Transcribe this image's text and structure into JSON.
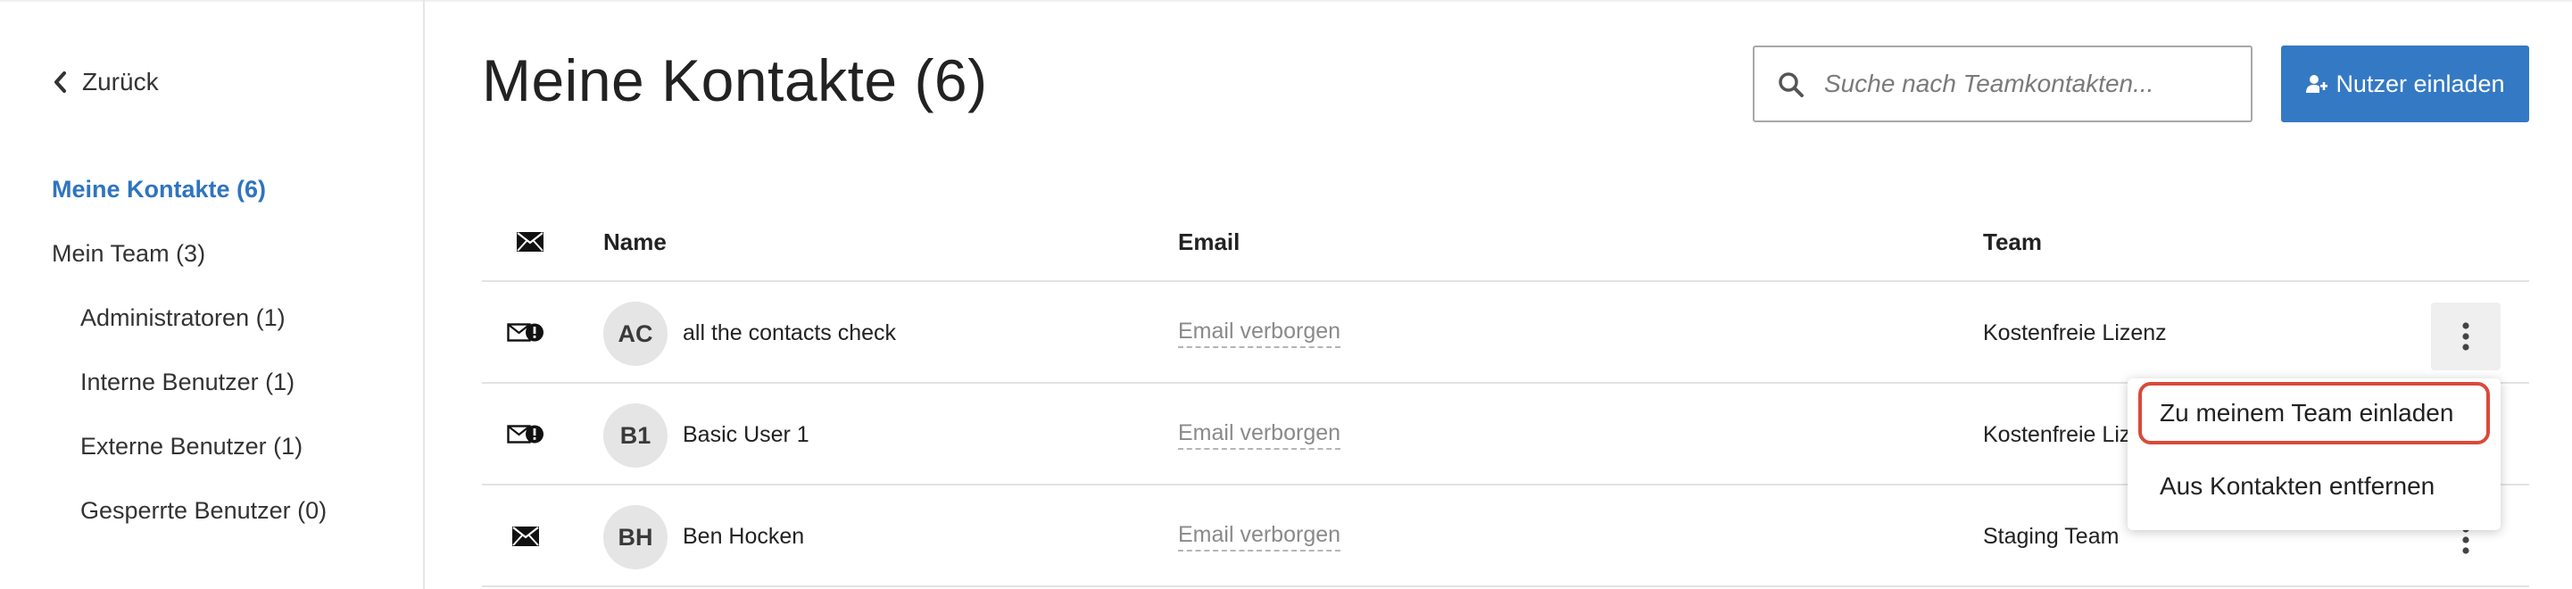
{
  "sidebar": {
    "back_label": "Zurück",
    "items": [
      {
        "label": "Meine Kontakte (6)",
        "active": true
      },
      {
        "label": "Mein Team (3)"
      },
      {
        "label": "Administratoren (1)"
      },
      {
        "label": "Interne Benutzer (1)"
      },
      {
        "label": "Externe Benutzer (1)"
      },
      {
        "label": "Gesperrte Benutzer (0)"
      }
    ]
  },
  "header": {
    "title": "Meine Kontakte (6)",
    "search_placeholder": "Suche nach Teamkontakten...",
    "invite_label": "Nutzer einladen"
  },
  "table": {
    "columns": {
      "name": "Name",
      "email": "Email",
      "team": "Team"
    },
    "rows": [
      {
        "initials": "AC",
        "name": "all the contacts check",
        "email": "Email verborgen",
        "team": "Kostenfreie Lizenz",
        "mail_status": "mail-warning-icon"
      },
      {
        "initials": "B1",
        "name": "Basic User 1",
        "email": "Email verborgen",
        "team": "Kostenfreie Lizenz",
        "mail_status": "mail-warning-icon"
      },
      {
        "initials": "BH",
        "name": "Ben Hocken",
        "email": "Email verborgen",
        "team": "Staging Team",
        "mail_status": "mail-icon"
      }
    ]
  },
  "menu": {
    "items": [
      {
        "label": "Zu meinem Team einladen",
        "highlighted": true
      },
      {
        "label": "Aus Kontakten entfernen"
      }
    ]
  },
  "colors": {
    "accent": "#3479c4",
    "active_nav": "#2f74c0",
    "highlight_border": "#d94a3a"
  }
}
